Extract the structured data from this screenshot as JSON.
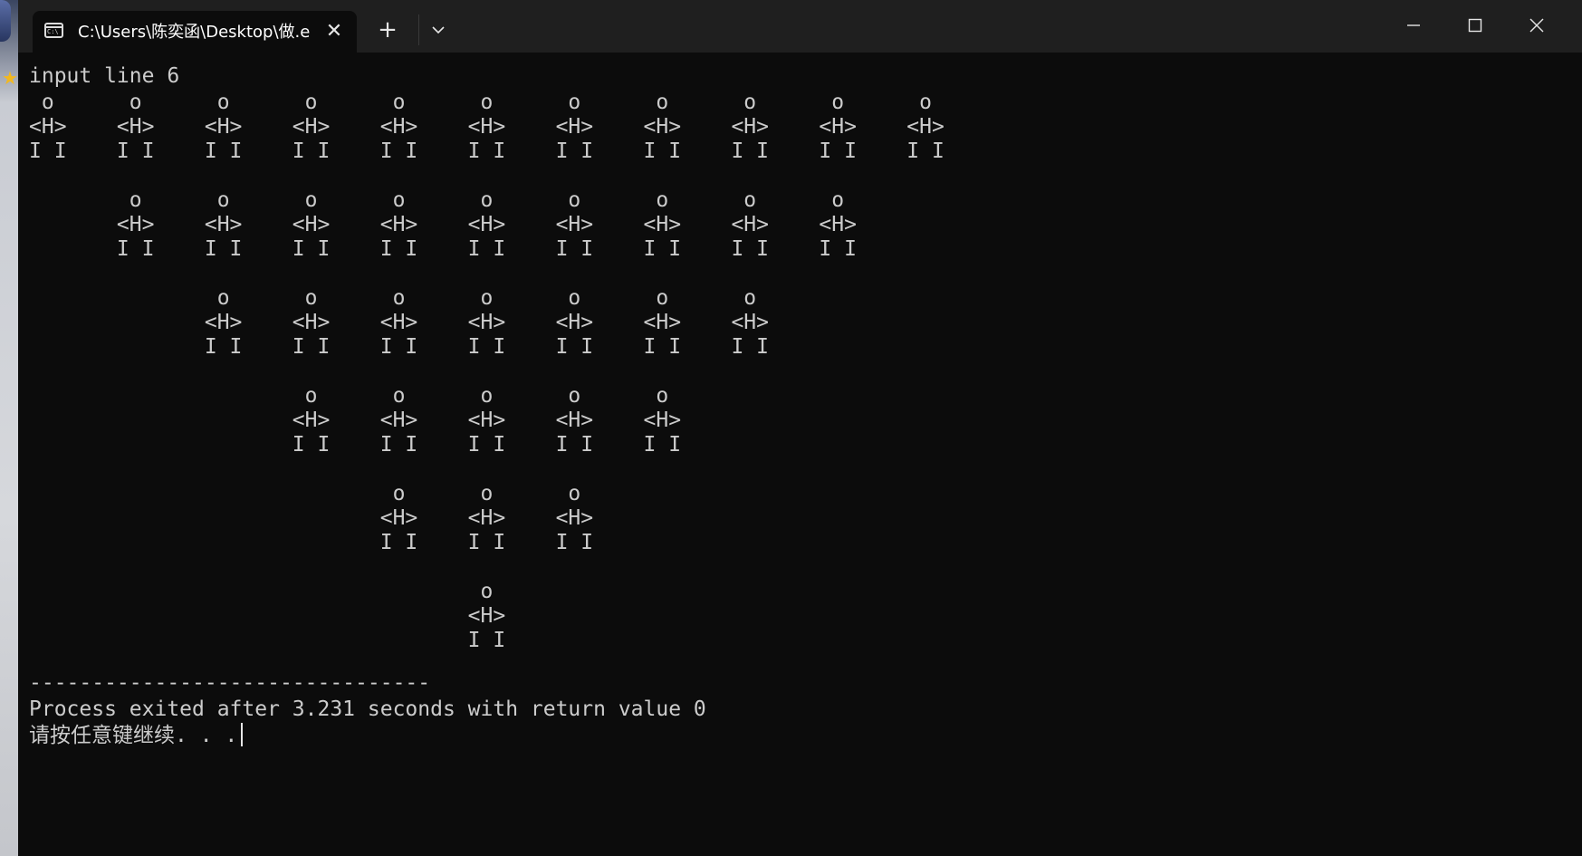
{
  "window": {
    "tab_title": "C:\\Users\\陈奕函\\Desktop\\做.e",
    "tab_icon": "cmd-icon",
    "controls": [
      "minimize-icon",
      "maximize-icon",
      "close-icon"
    ]
  },
  "console": {
    "prompt_line": "input line 6",
    "output_lines": [
      " o      o      o      o      o      o      o      o      o      o      o",
      "<H>    <H>    <H>    <H>    <H>    <H>    <H>    <H>    <H>    <H>    <H>",
      "I I    I I    I I    I I    I I    I I    I I    I I    I I    I I    I I",
      "",
      "        o      o      o      o      o      o      o      o      o",
      "       <H>    <H>    <H>    <H>    <H>    <H>    <H>    <H>    <H>",
      "       I I    I I    I I    I I    I I    I I    I I    I I    I I",
      "",
      "               o      o      o      o      o      o      o",
      "              <H>    <H>    <H>    <H>    <H>    <H>    <H>",
      "              I I    I I    I I    I I    I I    I I    I I",
      "",
      "                      o      o      o      o      o",
      "                     <H>    <H>    <H>    <H>    <H>",
      "                     I I    I I    I I    I I    I I",
      "",
      "                             o      o      o",
      "                            <H>    <H>    <H>",
      "                            I I    I I    I I",
      "",
      "                                    o",
      "                                   <H>",
      "                                   I I"
    ],
    "separator": "--------------------------------",
    "exit_message": "Process exited after 3.231 seconds with return value 0",
    "continue_prompt": "请按任意键继续. . ."
  }
}
